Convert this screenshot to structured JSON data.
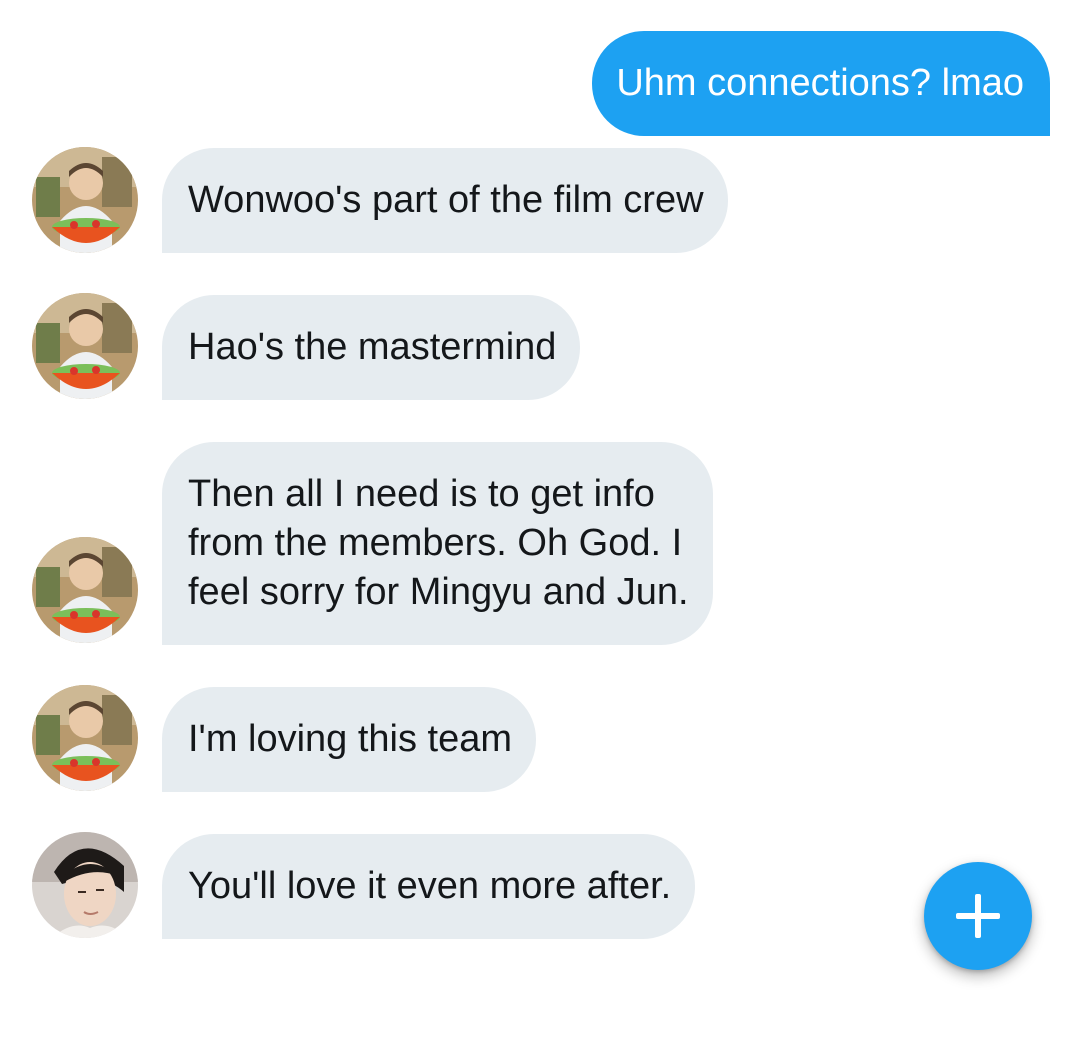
{
  "messages": [
    {
      "direction": "outgoing",
      "text": "Uhm connections? lmao"
    },
    {
      "direction": "incoming",
      "sender_avatar": "avatar-salad-photo",
      "text": "Wonwoo's part of the film crew"
    },
    {
      "direction": "incoming",
      "sender_avatar": "avatar-salad-photo",
      "text": "Hao's the mastermind"
    },
    {
      "direction": "incoming",
      "sender_avatar": "avatar-salad-photo",
      "text": "Then all I need is to get info\nfrom the members. Oh God. I\nfeel sorry for Mingyu and Jun."
    },
    {
      "direction": "incoming",
      "sender_avatar": "avatar-salad-photo",
      "text": "I'm loving this team"
    },
    {
      "direction": "incoming",
      "sender_avatar": "avatar-portrait-photo",
      "text": "You'll love it even more after."
    }
  ],
  "fab": {
    "icon": "plus-icon"
  },
  "colors": {
    "accent": "#1da1f2",
    "incoming_bubble": "#e6ecf0",
    "incoming_text": "#14171a",
    "outgoing_text": "#ffffff"
  }
}
